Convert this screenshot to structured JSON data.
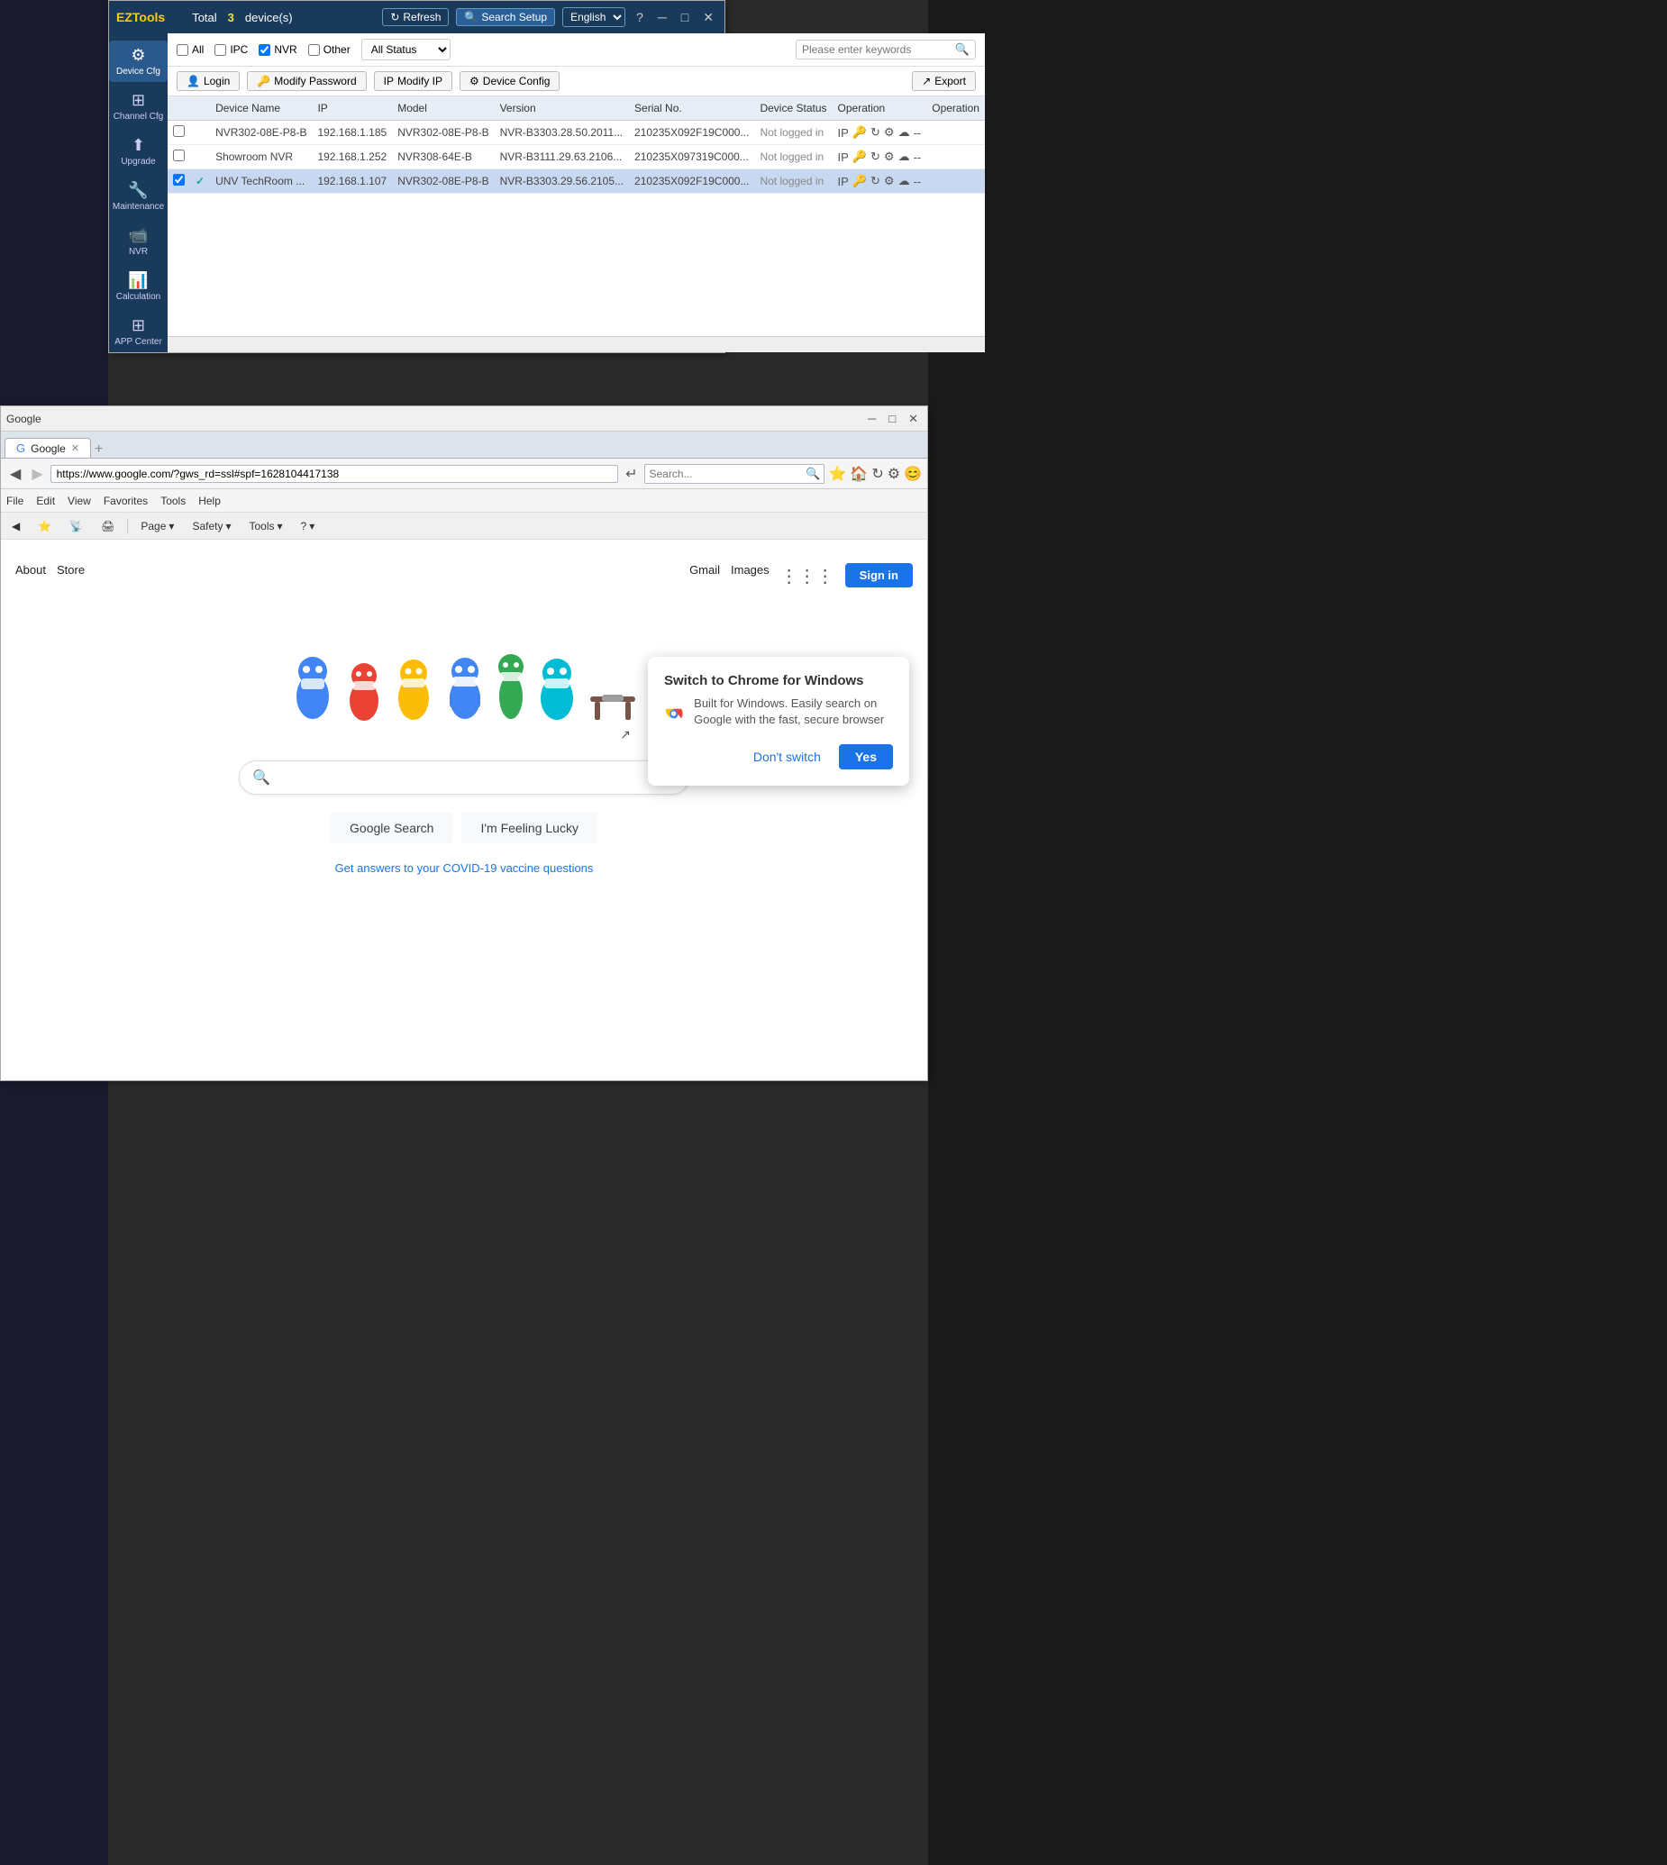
{
  "eztools": {
    "title": "EZTools",
    "total_label": "Total",
    "total_count": "3",
    "device_label": "device(s)",
    "refresh_btn": "Refresh",
    "search_setup_btn": "Search Setup",
    "language": "English",
    "filter": {
      "all": "All",
      "ipc": "IPC",
      "nvr": "NVR",
      "other": "Other",
      "status_placeholder": "All Status",
      "search_placeholder": "Please enter keywords"
    },
    "actions": {
      "login": "Login",
      "modify_password": "Modify Password",
      "modify_ip": "Modify IP",
      "device_config": "Device Config",
      "export": "Export"
    },
    "table": {
      "columns": [
        "",
        "",
        "Device Name",
        "IP",
        "Model",
        "Version",
        "Serial No.",
        "Device Status",
        "Operation",
        "Operation"
      ],
      "rows": [
        {
          "checked": false,
          "selected": false,
          "name": "NVR302-08E-P8-B",
          "ip": "192.168.1.185",
          "model": "NVR302-08E-P8-B",
          "version": "NVR-B3303.28.50.2011...",
          "serial": "210235X092F19C000...",
          "status": "Not logged in"
        },
        {
          "checked": false,
          "selected": false,
          "name": "Showroom NVR",
          "ip": "192.168.1.252",
          "model": "NVR308-64E-B",
          "version": "NVR-B3111.29.63.2106...",
          "serial": "210235X097319C000...",
          "status": "Not logged in"
        },
        {
          "checked": true,
          "selected": true,
          "name": "UNV TechRoom ...",
          "ip": "192.168.1.107",
          "model": "NVR302-08E-P8-B",
          "version": "NVR-B3303.29.56.2105...",
          "serial": "210235X092F19C000...",
          "status": "Not logged in"
        }
      ]
    }
  },
  "browser": {
    "title": "Google",
    "url": "https://www.google.com/?gws_rd=ssl#spf=1628104417138",
    "search_placeholder": "Search...",
    "tab_label": "Google",
    "menus": [
      "File",
      "Edit",
      "View",
      "Favorites",
      "Tools",
      "Help"
    ],
    "toolbar": {
      "page": "Page",
      "safety": "Safety",
      "tools": "Tools",
      "help_icon": "?"
    },
    "google": {
      "about": "About",
      "store": "Store",
      "gmail": "Gmail",
      "images": "Images",
      "sign_in": "Sign in",
      "search_btn": "Google Search",
      "lucky_btn": "I'm Feeling Lucky",
      "covid_link": "Get answers to your COVID-19 vaccine questions",
      "search_input_placeholder": ""
    },
    "chrome_popup": {
      "title": "Switch to Chrome for Windows",
      "body": "Built for Windows. Easily search on Google with the fast, secure browser",
      "dont_switch": "Don't switch",
      "yes": "Yes"
    }
  },
  "sidebar": {
    "items": [
      {
        "icon": "⚙",
        "label": "Device Cfg"
      },
      {
        "icon": "👥",
        "label": "Channel Cfg"
      },
      {
        "icon": "⬆",
        "label": "Upgrade"
      },
      {
        "icon": "🔧",
        "label": "Maintenance"
      },
      {
        "icon": "📹",
        "label": "NVR"
      },
      {
        "icon": "📊",
        "label": "Calculation"
      },
      {
        "icon": "⬛",
        "label": "APP Center"
      }
    ]
  }
}
